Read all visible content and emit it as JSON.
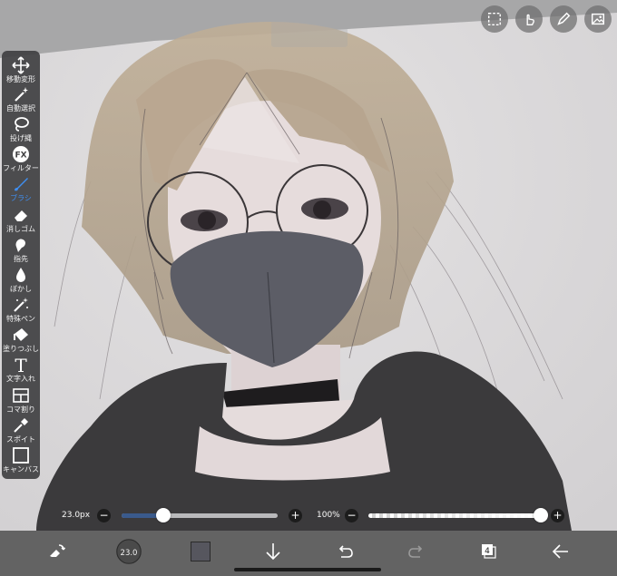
{
  "toolbar": {
    "items": [
      {
        "label": "移動変形",
        "icon": "move-icon"
      },
      {
        "label": "自動選択",
        "icon": "magic-wand-icon"
      },
      {
        "label": "投げ縄",
        "icon": "lasso-icon"
      },
      {
        "label": "フィルター",
        "icon": "fx-icon"
      },
      {
        "label": "ブラシ",
        "icon": "brush-icon",
        "active": true
      },
      {
        "label": "消しゴム",
        "icon": "eraser-icon"
      },
      {
        "label": "指先",
        "icon": "smudge-icon"
      },
      {
        "label": "ぼかし",
        "icon": "blur-icon"
      },
      {
        "label": "特殊ペン",
        "icon": "special-pen-icon"
      },
      {
        "label": "塗りつぶし",
        "icon": "fill-icon"
      },
      {
        "label": "文字入れ",
        "icon": "text-icon"
      },
      {
        "label": "コマ割り",
        "icon": "frame-divider-icon"
      },
      {
        "label": "スポイト",
        "icon": "eyedropper-icon"
      },
      {
        "label": "キャンバス",
        "icon": "canvas-icon"
      }
    ],
    "fx_text": "FX",
    "text_glyph": "T"
  },
  "sliders": {
    "brush_size_label": "23.0px",
    "brush_size_fraction": 0.27,
    "opacity_label": "100%",
    "opacity_fraction": 1.0,
    "minus": "−",
    "plus": "+"
  },
  "bottom_bar": {
    "brush_preview_value": "23.0",
    "layer_count": "4",
    "current_color": "#56565e"
  },
  "colors": {
    "active_tool": "#3f8ef0",
    "slider_fill": "#3a5a8c",
    "toolbar_bg": "#404042",
    "bottom_bar_bg": "#636363"
  }
}
